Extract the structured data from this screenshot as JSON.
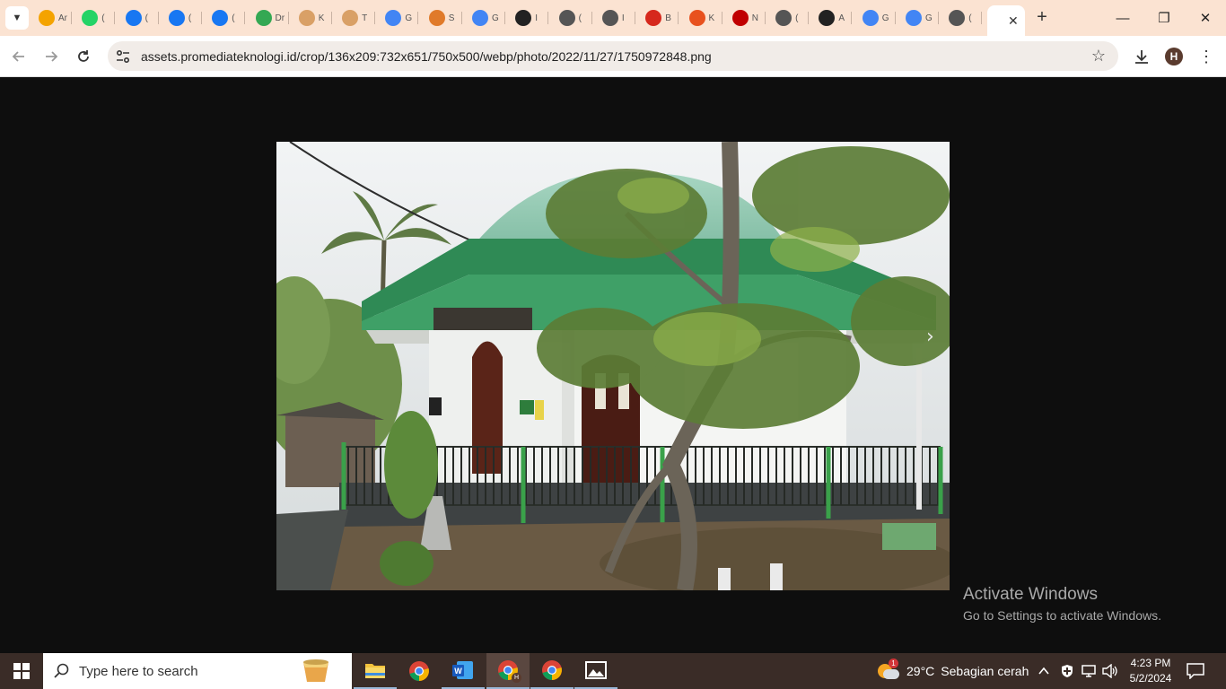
{
  "browser": {
    "tabs": [
      {
        "title": "Analytics",
        "icon": "analytics-icon",
        "color": "#f4a300"
      },
      {
        "title": "(",
        "icon": "whatsapp-icon",
        "color": "#25d366"
      },
      {
        "title": "(",
        "icon": "facebook-icon",
        "color": "#1877f2"
      },
      {
        "title": "(",
        "icon": "facebook-icon",
        "color": "#1877f2"
      },
      {
        "title": "(",
        "icon": "facebook-icon",
        "color": "#1877f2"
      },
      {
        "title": "Drive",
        "icon": "google-drive-icon",
        "color": "#34a853"
      },
      {
        "title": "K",
        "icon": "site-icon",
        "color": "#d9a066"
      },
      {
        "title": "T",
        "icon": "site-icon",
        "color": "#d9a066"
      },
      {
        "title": "G",
        "icon": "google-icon",
        "color": "#4285f4"
      },
      {
        "title": "S",
        "icon": "site-icon",
        "color": "#e07a2a"
      },
      {
        "title": "G",
        "icon": "google-icon",
        "color": "#4285f4"
      },
      {
        "title": "I",
        "icon": "site-icon",
        "color": "#222222"
      },
      {
        "title": "(",
        "icon": "globe-icon",
        "color": "#555555"
      },
      {
        "title": "I",
        "icon": "globe-icon",
        "color": "#555555"
      },
      {
        "title": "B",
        "icon": "site-icon",
        "color": "#d6281c"
      },
      {
        "title": "K",
        "icon": "site-icon",
        "color": "#e8511e"
      },
      {
        "title": "N",
        "icon": "site-icon",
        "color": "#c00000"
      },
      {
        "title": "(",
        "icon": "globe-icon",
        "color": "#555555"
      },
      {
        "title": "A",
        "icon": "site-icon",
        "color": "#222222"
      },
      {
        "title": "G",
        "icon": "google-icon",
        "color": "#4285f4"
      },
      {
        "title": "G",
        "icon": "google-icon",
        "color": "#4285f4"
      },
      {
        "title": "(",
        "icon": "globe-icon",
        "color": "#555555"
      }
    ],
    "active_tab": {
      "title": "",
      "close": "✕"
    },
    "new_tab": "+",
    "window_controls": {
      "minimize": "—",
      "restore": "❐",
      "close": "✕"
    },
    "address": "assets.promediateknologi.id/crop/136x209:732x651/750x500/webp/photo/2022/11/27/1750972848.png",
    "profile_initial": "H"
  },
  "watermark": {
    "title": "Activate Windows",
    "subtitle": "Go to Settings to activate Windows."
  },
  "taskbar": {
    "search_placeholder": "Type here to search",
    "weather_temp": "29°C",
    "weather_text": "Sebagian cerah",
    "weather_badge": "1",
    "time": "4:23 PM",
    "date": "5/2/2024",
    "chrome_badge": "H"
  }
}
